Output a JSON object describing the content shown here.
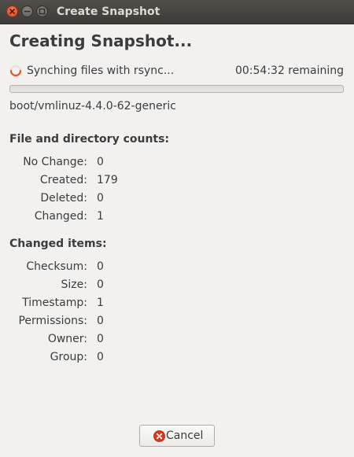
{
  "window": {
    "title": "Create Snapshot"
  },
  "main": {
    "heading": "Creating Snapshot...",
    "status_text": "Synching files with rsync...",
    "remaining": "00:54:32 remaining",
    "progress_fraction": 0,
    "current_file": "boot/vmlinuz-4.4.0-62-generic"
  },
  "counts": {
    "title": "File and directory counts:",
    "rows": [
      {
        "label": "No Change:",
        "value": "0"
      },
      {
        "label": "Created:",
        "value": "179"
      },
      {
        "label": "Deleted:",
        "value": "0"
      },
      {
        "label": "Changed:",
        "value": "1"
      }
    ]
  },
  "changed": {
    "title": "Changed items:",
    "rows": [
      {
        "label": "Checksum:",
        "value": "0"
      },
      {
        "label": "Size:",
        "value": "0"
      },
      {
        "label": "Timestamp:",
        "value": "1"
      },
      {
        "label": "Permissions:",
        "value": "0"
      },
      {
        "label": "Owner:",
        "value": "0"
      },
      {
        "label": "Group:",
        "value": "0"
      }
    ]
  },
  "footer": {
    "cancel_label": "Cancel"
  },
  "colors": {
    "accent": "#e95420",
    "titlebar": "#3c3b37",
    "background": "#f2f1f0"
  },
  "icons": {
    "window_close": "close-icon",
    "window_minimize": "minimize-icon",
    "window_maximize": "maximize-icon",
    "status": "spinner-icon",
    "cancel": "cancel-icon"
  }
}
